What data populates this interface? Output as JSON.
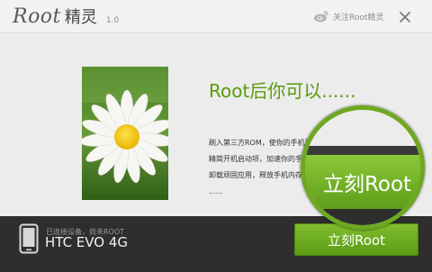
{
  "window": {
    "logo_text": "Root",
    "app_name": "精灵",
    "version": "1.0",
    "follow_label": "关注Root精灵"
  },
  "main": {
    "headline": "Root后你可以......",
    "desc_lines": [
      "刷入第三方ROM，使你的手机更有个性",
      "精简开机启动项，加速你的手机",
      "卸载顽固应用，释放手机内存",
      "......"
    ]
  },
  "bottom": {
    "status": "已连接设备，尚未ROOT",
    "device_name": "HTC EVO 4G",
    "root_button": "立刻Root"
  },
  "magnifier": {
    "label": "立刻Root"
  },
  "colors": {
    "accent_green": "#5c9b14",
    "headline_green": "#5a9b0a",
    "bottom_bar": "#2e2e2e"
  },
  "icons": [
    "weibo-icon",
    "close-icon",
    "phone-icon"
  ]
}
